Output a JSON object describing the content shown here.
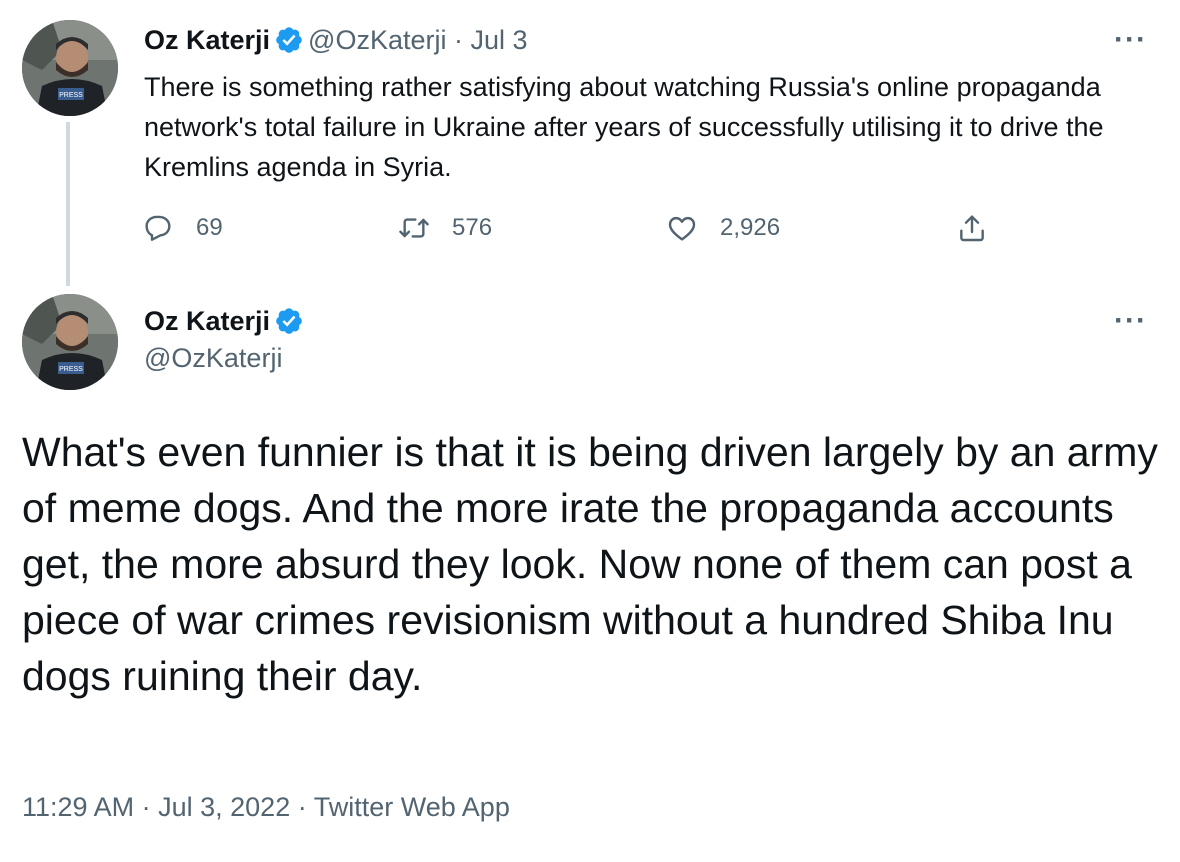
{
  "tweet1": {
    "author_name": "Oz Katerji",
    "handle": "@OzKaterji",
    "separator": "·",
    "date": "Jul 3",
    "text": "There is something rather satisfying about watching Russia's online propaganda network's total failure in Ukraine after years of successfully utilising it to drive the Kremlins agenda in Syria.",
    "avatar_badge": "PRESS",
    "stats": {
      "replies": "69",
      "retweets": "576",
      "likes": "2,926"
    },
    "more_label": "···"
  },
  "tweet2": {
    "author_name": "Oz Katerji",
    "handle": "@OzKaterji",
    "avatar_badge": "PRESS",
    "more_label": "···",
    "text": "What's even funnier is that it is being driven largely by an army of meme dogs. And the more irate the propaganda accounts get, the more absurd they look. Now none of them can post a piece of war crimes revisionism without a hundred Shiba Inu dogs ruining their day.",
    "time": "11:29 AM",
    "date": "Jul 3, 2022",
    "source": "Twitter Web App",
    "separator": "·"
  },
  "colors": {
    "text": "#0f1419",
    "secondary": "#536471",
    "verified": "#1d9bf0",
    "thread_line": "#cfd9de"
  },
  "icons": [
    "verified-icon",
    "more-icon",
    "reply-icon",
    "retweet-icon",
    "like-icon",
    "share-icon"
  ]
}
